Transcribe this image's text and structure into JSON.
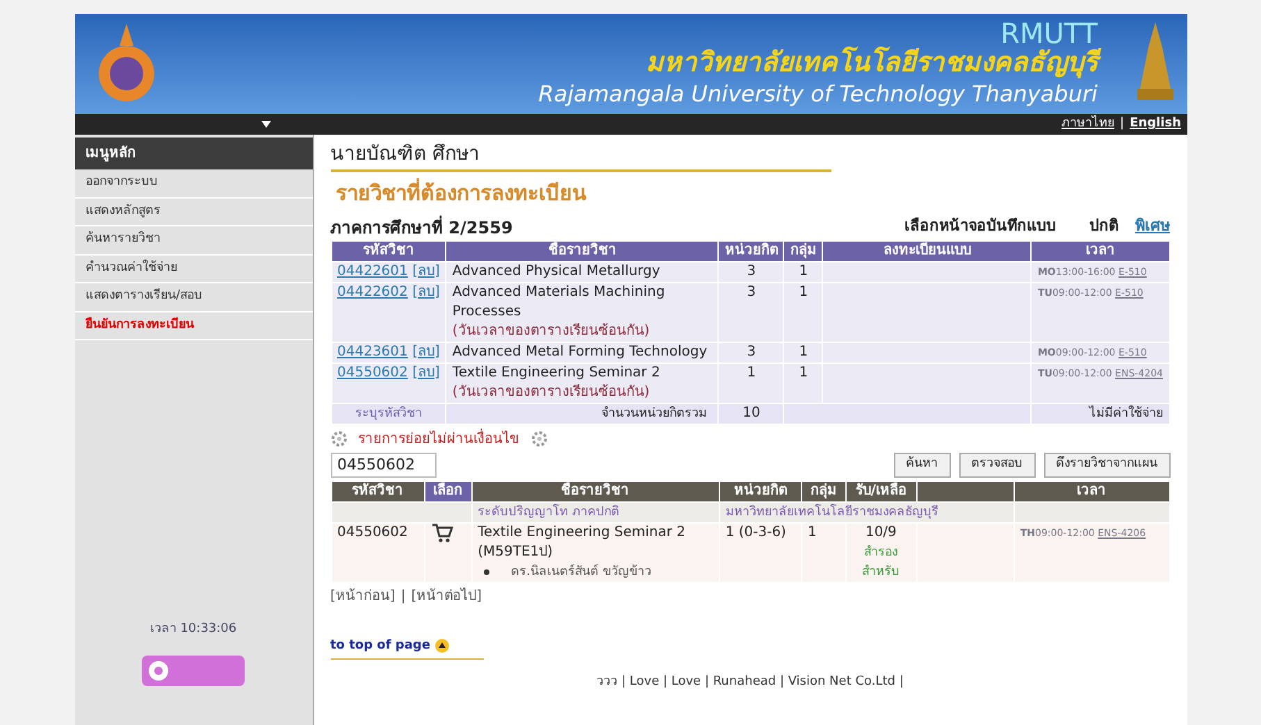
{
  "header": {
    "abbr": "RMUTT",
    "name_th": "มหาวิทยาลัยเทคโนโลยีราชมงคลธัญบุรี",
    "name_en": "Rajamangala University of Technology Thanyaburi",
    "languages": [
      {
        "label": "ภาษาไทย",
        "selected": false
      },
      {
        "label": "English",
        "selected": true
      }
    ],
    "separator": "|"
  },
  "sidebar": {
    "title": "เมนูหลัก",
    "items": [
      {
        "label": "ออกจากระบบ",
        "selected": false
      },
      {
        "label": "แสดงหลักสูตร",
        "selected": false
      },
      {
        "label": "ค้นหารายวิชา",
        "selected": false
      },
      {
        "label": "คำนวณค่าใช้จ่าย",
        "selected": false
      },
      {
        "label": "แสดงตารางเรียน/สอบ",
        "selected": false
      },
      {
        "label": "ยืนยันการลงทะเบียน",
        "selected": true
      }
    ],
    "clock": "เวลา 10:33:06"
  },
  "student": "นายบัณฑิต ศึกษา",
  "title": "รายวิชาที่ต้องการลงทะเบียน",
  "term": "ภาคการศึกษาที่ 2/2559",
  "mode": {
    "label": "เลือกหน้าจอบันทึกแบบ",
    "options": [
      {
        "label": "ปกติ",
        "selected": true
      },
      {
        "label": "พิเศษ",
        "selected": false
      }
    ]
  },
  "registered": {
    "columns": [
      "รหัสวิชา",
      "ชื่อรายวิชา",
      "หน่วยกิต",
      "กลุ่ม",
      "ลงทะเบียนแบบ",
      "เวลา"
    ],
    "rows": [
      {
        "code": "04422601",
        "remove": "[ลบ]",
        "name": "Advanced Physical Metallurgy",
        "credit": "3",
        "group": "1",
        "day": "MO",
        "time": "13:00-16:00",
        "room": "E-510"
      },
      {
        "code": "04422602",
        "remove": "[ลบ]",
        "name": "Advanced Materials Machining Processes",
        "note": "(วันเวลาของตารางเรียนซ้อนกัน)",
        "credit": "3",
        "group": "1",
        "day": "TU",
        "time": "09:00-12:00",
        "room": "E-510"
      },
      {
        "code": "04423601",
        "remove": "[ลบ]",
        "name": "Advanced Metal Forming Technology",
        "credit": "3",
        "group": "1",
        "day": "MO",
        "time": "09:00-12:00",
        "room": "E-510"
      },
      {
        "code": "04550602",
        "remove": "[ลบ]",
        "name": "Textile Engineering Seminar 2",
        "note": "(วันเวลาของตารางเรียนซ้อนกัน)",
        "credit": "1",
        "group": "1",
        "day": "TU",
        "time": "09:00-12:00",
        "room": "ENS-4204"
      }
    ],
    "summary": {
      "code_label": "ระบุรหัสวิชา",
      "total_label": "จำนวนหน่วยกิตรวม",
      "total": "10",
      "fee": "ไม่มีค่าใช้จ่าย"
    }
  },
  "warning": "รายการย่อยไม่ผ่านเงื่อนไข",
  "search": {
    "value": "04550602",
    "buttons": [
      "ค้นหา",
      "ตรวจสอบ",
      "ดึงรายวิชาจากแผน"
    ]
  },
  "results": {
    "columns": [
      {
        "label": "รหัสวิชา",
        "selected": false
      },
      {
        "label": "เลือก",
        "selected": true
      },
      {
        "label": "ชื่อรายวิชา",
        "selected": false
      },
      {
        "label": "หน่วยกิต",
        "selected": false
      },
      {
        "label": "กลุ่ม",
        "selected": false
      },
      {
        "label": "รับ/เหลือ",
        "selected": false
      },
      {
        "label": "เวลา",
        "selected": false
      }
    ],
    "level": "ระดับปริญญาโท ภาคปกติ",
    "campus": "มหาวิทยาลัยเทคโนโลยีราชมงคลธัญบุรี",
    "rows": [
      {
        "code": "04550602",
        "name": "Textile Engineering Seminar 2",
        "section": "(M59TE1ป)",
        "teacher": "ดร.นิลเนตร์สันต์ ขวัญข้าว",
        "credit": "1 (0-3-6)",
        "group": "1",
        "seats": "10/9",
        "reserve": "สำรอง",
        "reserve_for": "สำหรับ",
        "day": "TH",
        "time": "09:00-12:00",
        "room": "ENS-4206"
      }
    ]
  },
  "pager": [
    "[หน้าก่อน]",
    "|",
    "[หน้าต่อไป]"
  ],
  "top_link": "to top of page",
  "footer": "ววว | Love | Love | Runahead | Vision Net Co.Ltd |"
}
